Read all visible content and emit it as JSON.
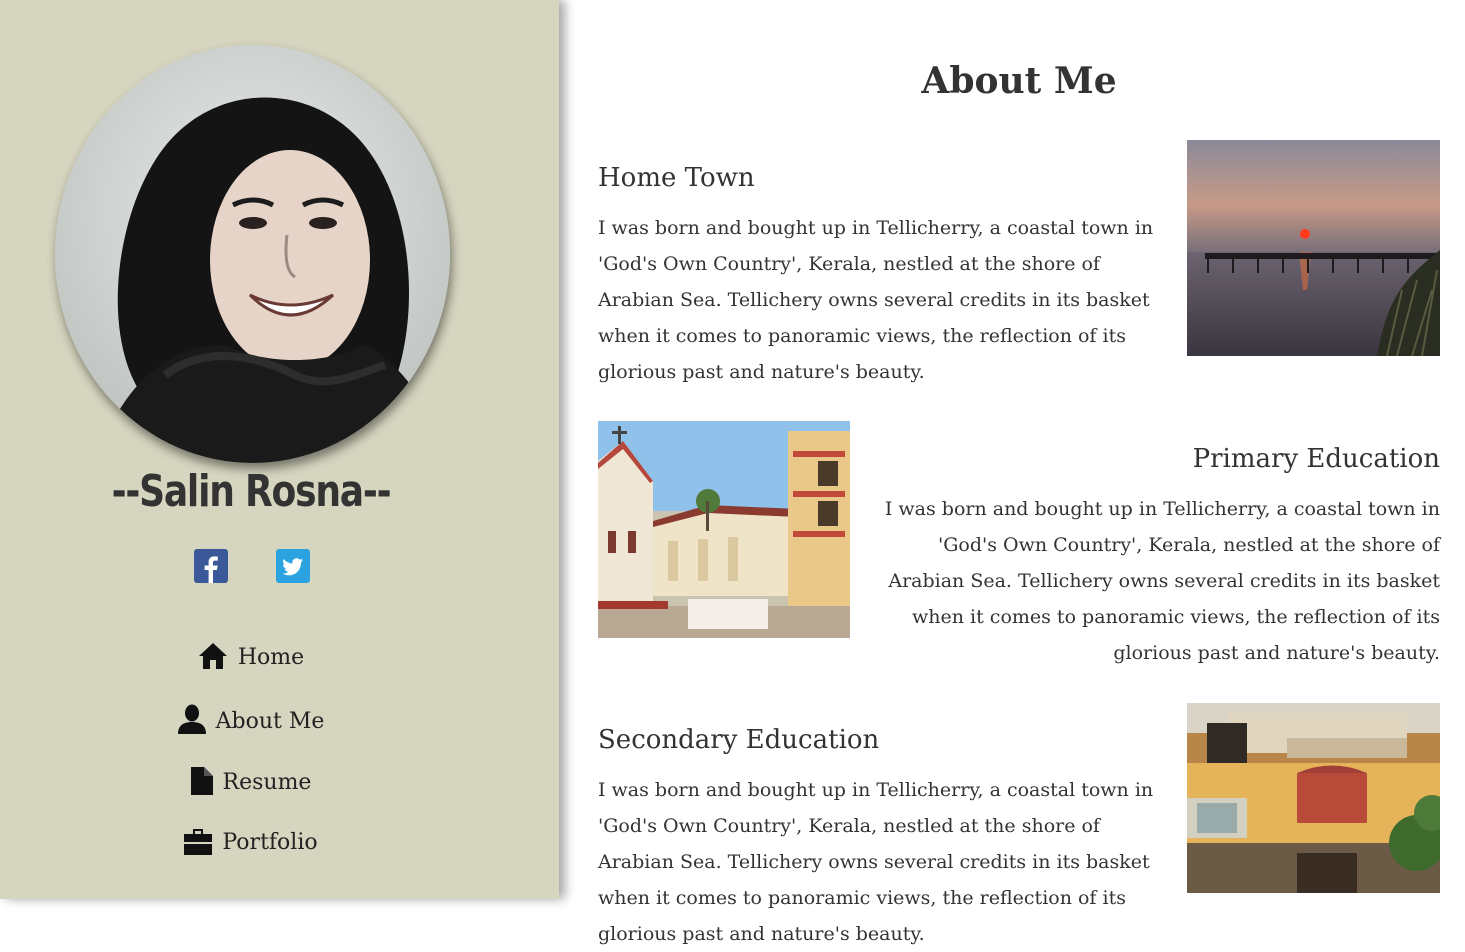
{
  "profile": {
    "name": "--Salin Rosna--"
  },
  "social": {
    "facebook_icon": "facebook-icon",
    "twitter_icon": "twitter-icon",
    "facebook_color": "#3b5998",
    "twitter_color": "#2aa3e0"
  },
  "nav": {
    "items": [
      {
        "label": "Home",
        "icon": "home-icon"
      },
      {
        "label": "About Me",
        "icon": "user-icon"
      },
      {
        "label": "Resume",
        "icon": "file-icon"
      },
      {
        "label": "Portfolio",
        "icon": "briefcase-icon"
      }
    ]
  },
  "main": {
    "title": "About Me",
    "sections": [
      {
        "heading": "Home Town",
        "text": "I was born and bought up in Tellicherry, a coastal town in 'God's Own Country', Kerala, nestled at the shore of Arabian Sea. Tellichery owns several credits in its basket when it comes to panoramic views, the reflection of its glorious past and nature's beauty."
      },
      {
        "heading": "Primary Education",
        "text": "I was born and bought up in Tellicherry, a coastal town in 'God's Own Country', Kerala, nestled at the shore of Arabian Sea. Tellichery owns several credits in its basket when it comes to panoramic views, the reflection of its glorious past and nature's beauty."
      },
      {
        "heading": "Secondary Education",
        "text": "I was born and bought up in Tellicherry, a coastal town in 'God's Own Country', Kerala, nestled at the shore of Arabian Sea. Tellichery owns several credits in its basket when it comes to panoramic views, the reflection of its glorious past and nature's beauty."
      }
    ]
  },
  "colors": {
    "sidebar_bg": "#d6d5bf",
    "text": "#333333"
  }
}
